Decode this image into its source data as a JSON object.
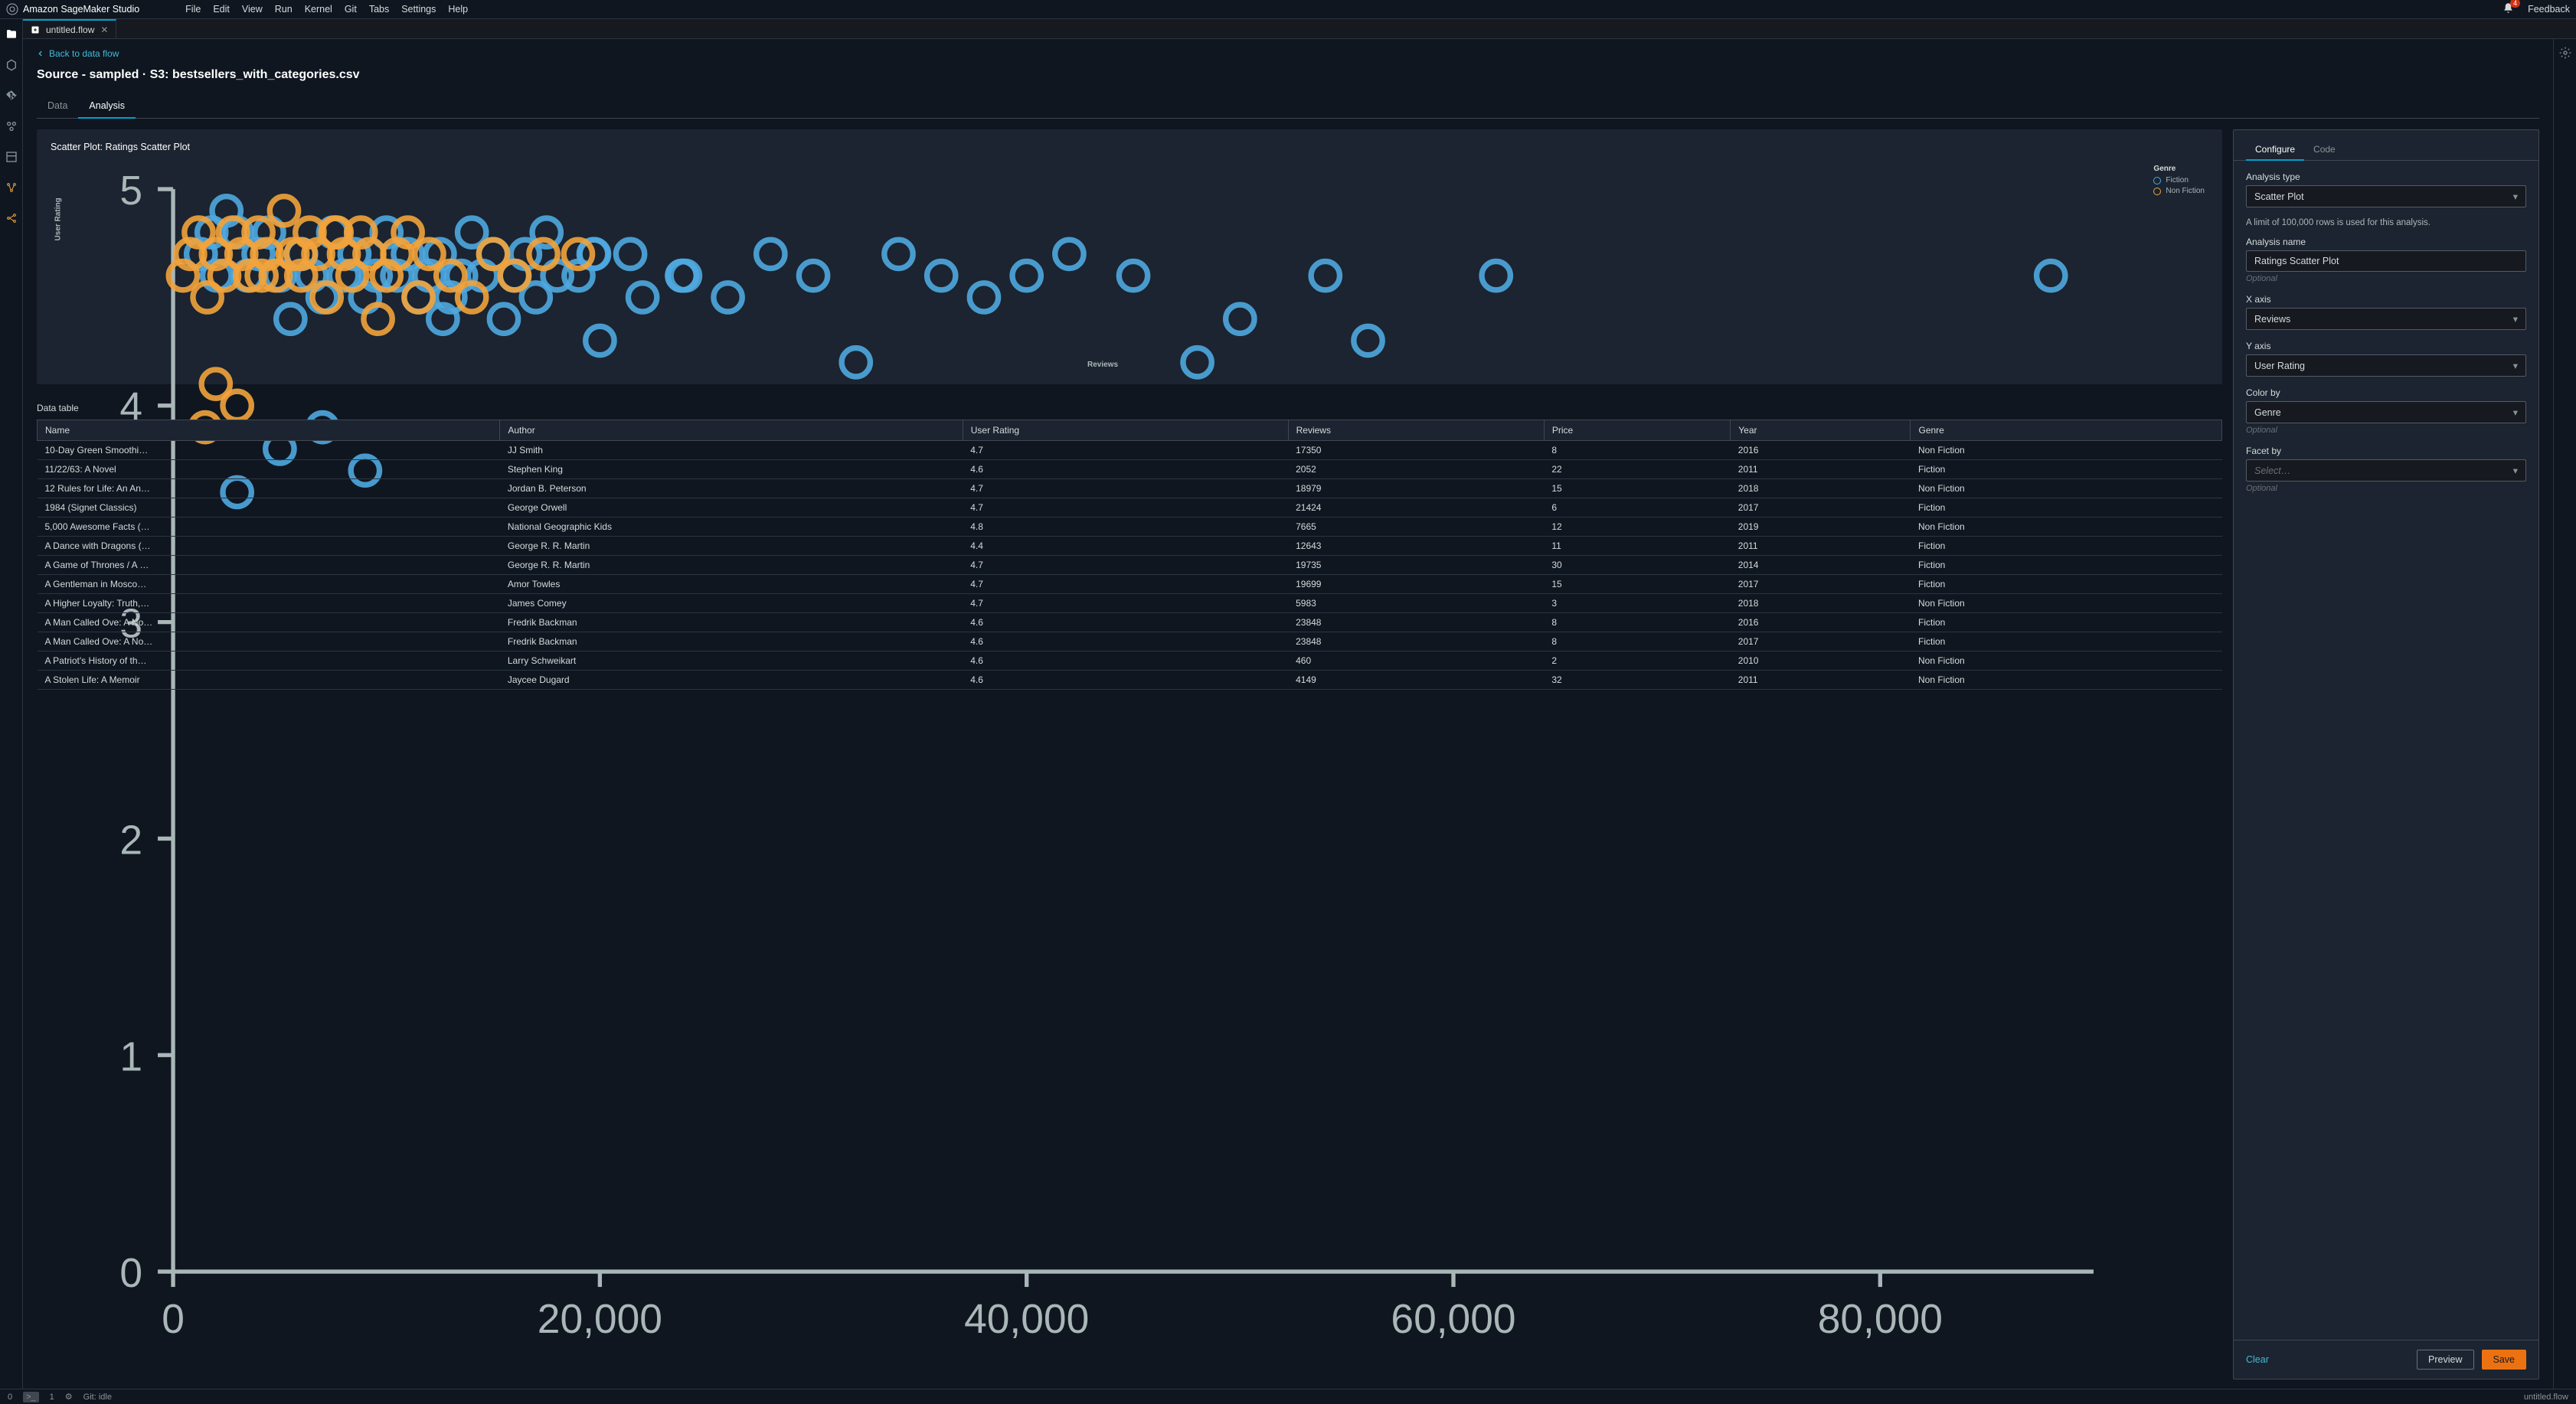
{
  "app": {
    "title": "Amazon SageMaker Studio",
    "feedback": "Feedback",
    "bell_badge": "4"
  },
  "menu": [
    "File",
    "Edit",
    "View",
    "Run",
    "Kernel",
    "Git",
    "Tabs",
    "Settings",
    "Help"
  ],
  "tab": {
    "name": "untitled.flow"
  },
  "breadcrumb": "Back to data flow",
  "source_title": "Source - sampled · S3: bestsellers_with_categories.csv",
  "inner_tabs": {
    "data": "Data",
    "analysis": "Analysis"
  },
  "chart": {
    "title": "Scatter Plot: Ratings Scatter Plot"
  },
  "chart_data": {
    "type": "scatter",
    "title": "Scatter Plot: Ratings Scatter Plot",
    "xlabel": "Reviews",
    "ylabel": "User Rating",
    "xlim": [
      0,
      90000
    ],
    "ylim": [
      0,
      5
    ],
    "xticks": [
      0,
      20000,
      40000,
      60000,
      80000
    ],
    "yticks": [
      0,
      1,
      2,
      3,
      4,
      5
    ],
    "legend_title": "Genre",
    "series": [
      {
        "name": "Fiction",
        "color": "#4fa8e0",
        "points": [
          [
            2052,
            4.6
          ],
          [
            12643,
            4.4
          ],
          [
            21424,
            4.7
          ],
          [
            19735,
            4.7
          ],
          [
            19699,
            4.7
          ],
          [
            23848,
            4.6
          ],
          [
            23848,
            4.6
          ],
          [
            1300,
            4.7
          ],
          [
            1800,
            4.8
          ],
          [
            2500,
            4.9
          ],
          [
            3000,
            4.8
          ],
          [
            3500,
            4.6
          ],
          [
            4000,
            4.7
          ],
          [
            4500,
            4.8
          ],
          [
            5000,
            4.6
          ],
          [
            5500,
            4.4
          ],
          [
            6000,
            4.7
          ],
          [
            6500,
            4.6
          ],
          [
            7000,
            4.5
          ],
          [
            7500,
            4.8
          ],
          [
            8000,
            4.6
          ],
          [
            8500,
            4.7
          ],
          [
            9000,
            4.5
          ],
          [
            9500,
            4.6
          ],
          [
            10000,
            4.8
          ],
          [
            10500,
            4.6
          ],
          [
            11000,
            4.7
          ],
          [
            11500,
            4.5
          ],
          [
            12000,
            4.6
          ],
          [
            12500,
            4.7
          ],
          [
            13000,
            4.5
          ],
          [
            13500,
            4.6
          ],
          [
            14000,
            4.8
          ],
          [
            14500,
            4.6
          ],
          [
            15000,
            4.7
          ],
          [
            15500,
            4.4
          ],
          [
            16000,
            4.6
          ],
          [
            16500,
            4.7
          ],
          [
            17000,
            4.5
          ],
          [
            17500,
            4.8
          ],
          [
            18000,
            4.6
          ],
          [
            19000,
            4.6
          ],
          [
            20000,
            4.3
          ],
          [
            22000,
            4.5
          ],
          [
            24000,
            4.6
          ],
          [
            26000,
            4.5
          ],
          [
            28000,
            4.7
          ],
          [
            30000,
            4.6
          ],
          [
            32000,
            4.2
          ],
          [
            34000,
            4.7
          ],
          [
            36000,
            4.6
          ],
          [
            38000,
            4.5
          ],
          [
            40000,
            4.6
          ],
          [
            42000,
            4.7
          ],
          [
            45000,
            4.6
          ],
          [
            48000,
            4.2
          ],
          [
            50000,
            4.4
          ],
          [
            54000,
            4.6
          ],
          [
            56000,
            4.3
          ],
          [
            62000,
            4.6
          ],
          [
            88000,
            4.6
          ],
          [
            5000,
            3.8
          ],
          [
            7000,
            3.9
          ],
          [
            3000,
            3.6
          ],
          [
            9000,
            3.7
          ]
        ]
      },
      {
        "name": "Non Fiction",
        "color": "#f2a33c",
        "points": [
          [
            17350,
            4.7
          ],
          [
            18979,
            4.7
          ],
          [
            7665,
            4.8
          ],
          [
            5983,
            4.7
          ],
          [
            460,
            4.6
          ],
          [
            4149,
            4.6
          ],
          [
            800,
            4.7
          ],
          [
            1200,
            4.8
          ],
          [
            1600,
            4.5
          ],
          [
            2000,
            4.7
          ],
          [
            2400,
            4.6
          ],
          [
            2800,
            4.8
          ],
          [
            3200,
            4.7
          ],
          [
            3600,
            4.6
          ],
          [
            4000,
            4.8
          ],
          [
            4400,
            4.7
          ],
          [
            4800,
            4.6
          ],
          [
            5200,
            4.9
          ],
          [
            5600,
            4.7
          ],
          [
            6000,
            4.6
          ],
          [
            6400,
            4.8
          ],
          [
            6800,
            4.7
          ],
          [
            7200,
            4.5
          ],
          [
            7600,
            4.8
          ],
          [
            8000,
            4.7
          ],
          [
            8400,
            4.6
          ],
          [
            8800,
            4.8
          ],
          [
            9200,
            4.7
          ],
          [
            9600,
            4.4
          ],
          [
            10000,
            4.6
          ],
          [
            10500,
            4.7
          ],
          [
            11000,
            4.8
          ],
          [
            11500,
            4.5
          ],
          [
            12000,
            4.7
          ],
          [
            13000,
            4.6
          ],
          [
            14000,
            4.5
          ],
          [
            15000,
            4.7
          ],
          [
            16000,
            4.6
          ],
          [
            2000,
            4.1
          ],
          [
            3000,
            4.0
          ],
          [
            1500,
            3.9
          ]
        ]
      }
    ]
  },
  "datatable": {
    "label": "Data table",
    "columns": [
      "Name",
      "Author",
      "User Rating",
      "Reviews",
      "Price",
      "Year",
      "Genre"
    ],
    "rows": [
      [
        "10-Day Green Smoothi…",
        "JJ Smith",
        "4.7",
        "17350",
        "8",
        "2016",
        "Non Fiction"
      ],
      [
        "11/22/63: A Novel",
        "Stephen King",
        "4.6",
        "2052",
        "22",
        "2011",
        "Fiction"
      ],
      [
        "12 Rules for Life: An An…",
        "Jordan B. Peterson",
        "4.7",
        "18979",
        "15",
        "2018",
        "Non Fiction"
      ],
      [
        "1984 (Signet Classics)",
        "George Orwell",
        "4.7",
        "21424",
        "6",
        "2017",
        "Fiction"
      ],
      [
        "5,000 Awesome Facts (…",
        "National Geographic Kids",
        "4.8",
        "7665",
        "12",
        "2019",
        "Non Fiction"
      ],
      [
        "A Dance with Dragons (…",
        "George R. R. Martin",
        "4.4",
        "12643",
        "11",
        "2011",
        "Fiction"
      ],
      [
        "A Game of Thrones / A …",
        "George R. R. Martin",
        "4.7",
        "19735",
        "30",
        "2014",
        "Fiction"
      ],
      [
        "A Gentleman in Mosco…",
        "Amor Towles",
        "4.7",
        "19699",
        "15",
        "2017",
        "Fiction"
      ],
      [
        "A Higher Loyalty: Truth,…",
        "James Comey",
        "4.7",
        "5983",
        "3",
        "2018",
        "Non Fiction"
      ],
      [
        "A Man Called Ove: A No…",
        "Fredrik Backman",
        "4.6",
        "23848",
        "8",
        "2016",
        "Fiction"
      ],
      [
        "A Man Called Ove: A No…",
        "Fredrik Backman",
        "4.6",
        "23848",
        "8",
        "2017",
        "Fiction"
      ],
      [
        "A Patriot's History of th…",
        "Larry Schweikart",
        "4.6",
        "460",
        "2",
        "2010",
        "Non Fiction"
      ],
      [
        "A Stolen Life: A Memoir",
        "Jaycee Dugard",
        "4.6",
        "4149",
        "32",
        "2011",
        "Non Fiction"
      ]
    ]
  },
  "config": {
    "tabs": {
      "configure": "Configure",
      "code": "Code"
    },
    "analysis_type_label": "Analysis type",
    "analysis_type_value": "Scatter Plot",
    "limit_note": "A limit of 100,000 rows is used for this analysis.",
    "analysis_name_label": "Analysis name",
    "analysis_name_value": "Ratings Scatter Plot",
    "optional": "Optional",
    "x_axis_label": "X axis",
    "x_axis_value": "Reviews",
    "y_axis_label": "Y axis",
    "y_axis_value": "User Rating",
    "color_by_label": "Color by",
    "color_by_value": "Genre",
    "facet_by_label": "Facet by",
    "facet_by_placeholder": "Select…",
    "clear": "Clear",
    "preview": "Preview",
    "save": "Save"
  },
  "status": {
    "left0": "0",
    "left1": "1",
    "git": "Git: idle",
    "right_file": "untitled.flow"
  }
}
